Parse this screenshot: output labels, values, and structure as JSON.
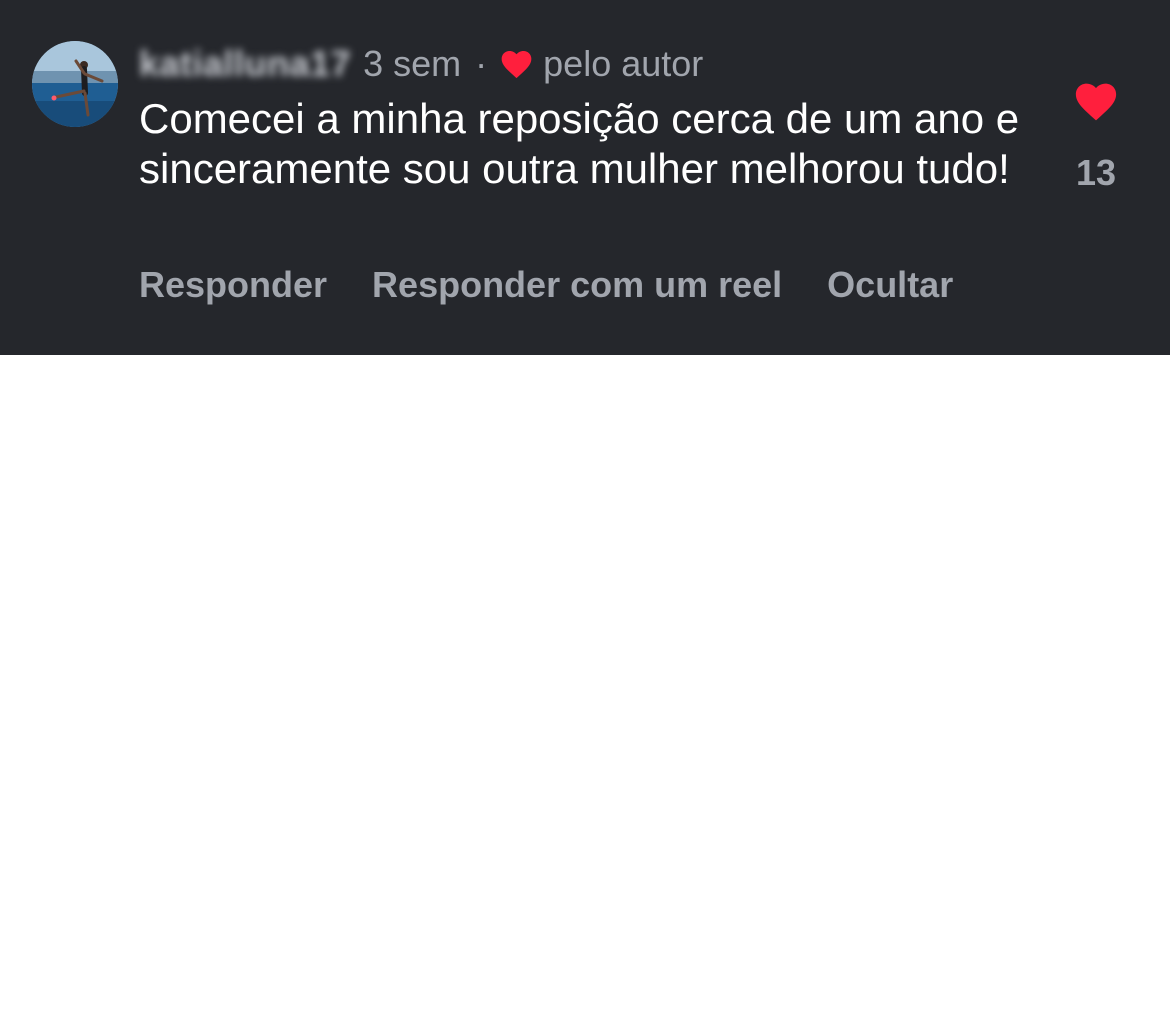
{
  "comment": {
    "username": "katialluna17",
    "time": "3 sem",
    "separator": "·",
    "author_like_label": "pelo autor",
    "text": "Comecei a minha reposição cerca de um ano e sinceramente sou outra mulher melhorou tudo!",
    "like_count": "13",
    "liked": true,
    "accent_color": "#ff1f3d",
    "background_color": "#25272c"
  },
  "actions": {
    "reply_label": "Responder",
    "reply_reel_label": "Responder com um reel",
    "hide_label": "Ocultar"
  },
  "icons": {
    "author_like": "heart-icon",
    "like": "heart-icon"
  }
}
